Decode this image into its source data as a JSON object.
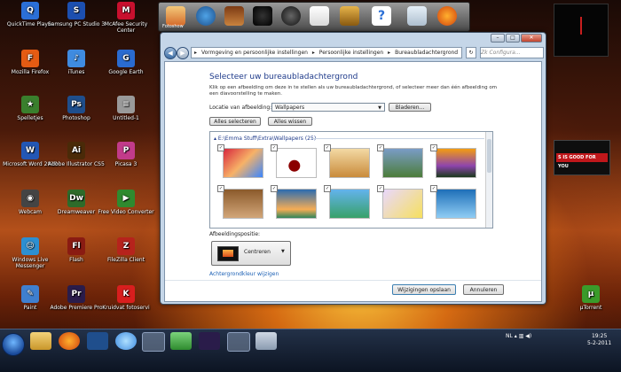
{
  "desktop_icons": [
    {
      "label": "QuickTime Player",
      "color": "#2b6fd6",
      "glyph": "Q"
    },
    {
      "label": "Samsung PC Studio 3",
      "color": "#1c4fb0",
      "glyph": "S"
    },
    {
      "label": "McAfee Security Center",
      "color": "#c8102e",
      "glyph": "M"
    },
    {
      "label": "Mozilla Firefox",
      "color": "#e55b13",
      "glyph": "F"
    },
    {
      "label": "iTunes",
      "color": "#3f8be0",
      "glyph": "♪"
    },
    {
      "label": "Google Earth",
      "color": "#2a6bd0",
      "glyph": "G"
    },
    {
      "label": "Spelletjes",
      "color": "#3a7f2d",
      "glyph": "★"
    },
    {
      "label": "Photoshop",
      "color": "#1f4e8c",
      "glyph": "Ps"
    },
    {
      "label": "Untitled-1",
      "color": "#9a9a9a",
      "glyph": "≡"
    },
    {
      "label": "Microsoft Word 2010",
      "color": "#2357b5",
      "glyph": "W"
    },
    {
      "label": "Adobe Illustrator CS5",
      "color": "#4a2a08",
      "glyph": "Ai"
    },
    {
      "label": "Picasa 3",
      "color": "#c23b8a",
      "glyph": "P"
    },
    {
      "label": "Webcam",
      "color": "#444444",
      "glyph": "◉"
    },
    {
      "label": "Dreamweaver",
      "color": "#2e6b2a",
      "glyph": "Dw"
    },
    {
      "label": "Free Video Converter",
      "color": "#2f8a2f",
      "glyph": "▶"
    },
    {
      "label": "Windows Live Messenger",
      "color": "#2d8fd1",
      "glyph": "☺"
    },
    {
      "label": "Flash",
      "color": "#8a1b12",
      "glyph": "Fl"
    },
    {
      "label": "FileZilla Client",
      "color": "#b6231c",
      "glyph": "Z"
    },
    {
      "label": "Paint",
      "color": "#3f7fcf",
      "glyph": "✎"
    },
    {
      "label": "Adobe Premiere Pro",
      "color": "#2a1c4a",
      "glyph": "Pr"
    },
    {
      "label": "Kruidvat fotoservi",
      "color": "#d81e1e",
      "glyph": "K"
    },
    {
      "label": "µTorrent",
      "color": "#3a9b2a",
      "glyph": "µ"
    }
  ],
  "dock": {
    "first_label": "Fotoshow"
  },
  "window": {
    "breadcrumb": [
      "Vormgeving en persoonlijke instellingen",
      "Persoonlijke instellingen",
      "Bureaubladachtergrond"
    ],
    "search_placeholder": "Zk Configura...",
    "title": "Selecteer uw bureaubladachtergrond",
    "description": "Klik op een afbeelding om deze in te stellen als uw bureaubladachtergrond, of selecteer meer dan één afbeelding om een diavoorstelling te maken.",
    "location_label": "Locatie van afbeelding:",
    "location_value": "Wallpapers",
    "browse_button": "Bladeren...",
    "select_all": "Alles selecteren",
    "clear_all": "Alles wissen",
    "folder": "E:\\Emma Stuff\\Extra\\Wallpapers (25)",
    "position_label": "Afbeeldingspositie:",
    "position_value": "Centreren",
    "color_link": "Achtergrondkleur wijzigen",
    "save_button": "Wijzigingen opslaan",
    "cancel_button": "Annuleren",
    "thumbnails": [
      {
        "fill": "linear-gradient(135deg,#d7263d,#f7b267,#3a86ff)",
        "checked": true
      },
      {
        "fill": "radial-gradient(circle at 45% 60%,#8b0000 20%,#fff 22%)",
        "checked": true
      },
      {
        "fill": "linear-gradient(#f3d9a4,#c98b3b)",
        "checked": true
      },
      {
        "fill": "linear-gradient(#7a9cc6,#4c7d3a)",
        "checked": true
      },
      {
        "fill": "linear-gradient(#f39c12,#8e44ad 60%,#1b3a1b)",
        "checked": true
      },
      {
        "fill": "linear-gradient(#8b5a2b,#d2a679)",
        "checked": true
      },
      {
        "fill": "linear-gradient(#2b6cb0,#f6ad55 70%,#2f855a)",
        "checked": true
      },
      {
        "fill": "linear-gradient(#63b3ed,#38a169)",
        "checked": true
      },
      {
        "fill": "linear-gradient(135deg,#e9d8fd,#f6e05e)",
        "checked": true
      },
      {
        "fill": "linear-gradient(#1e6fb8,#90cdf4)",
        "checked": true
      }
    ]
  },
  "widgets": {
    "ad_text": "S IS GOOD FOR YOU"
  },
  "taskbar": {
    "language": "NL",
    "time": "19:25",
    "date": "5-2-2011"
  }
}
